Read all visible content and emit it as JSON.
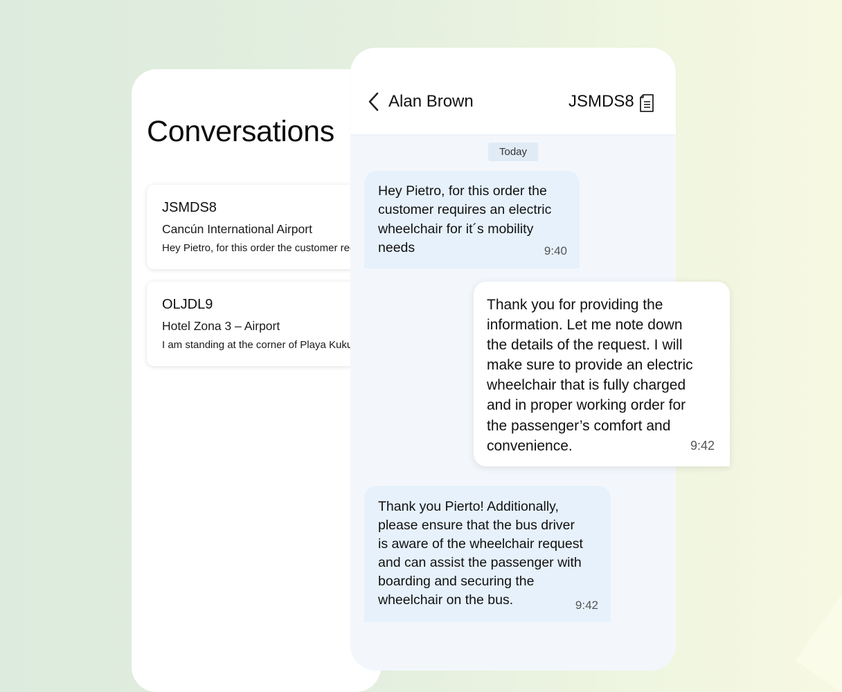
{
  "conversations": {
    "title": "Conversations",
    "items": [
      {
        "code": "JSMDS8",
        "location": "Cancún International Airport",
        "preview": "Hey Pietro, for this order  the customer requires an electric wheelchair"
      },
      {
        "code": "OLJDL9",
        "location": "Hotel Zona 3 – Airport",
        "preview": "I am standing at the corner of Playa Kukulcan"
      }
    ]
  },
  "chat": {
    "contact_name": "Alan Brown",
    "order_code": "JSMDS8",
    "date_label": "Today",
    "messages": [
      {
        "direction": "incoming",
        "text": "Hey Pietro, for this order the\ncustomer requires an electric\nwheelchair for it´s mobility\nneeds",
        "time": "9:40"
      },
      {
        "direction": "outgoing",
        "text": "Thank you for providing the\ninformation. Let me note down\nthe details of the request. I will\nmake sure to provide an electric\nwheelchair that is fully charged\nand in proper working order for\nthe passenger’s comfort and\nconvenience.",
        "time": "9:42"
      },
      {
        "direction": "incoming",
        "text": "Thank you Pierto! Additionally,\nplease ensure that the bus driver\nis aware of the wheelchair request\nand can assist the passenger with\nboarding and securing the\nwheelchair on the bus.",
        "time": "9:42"
      }
    ]
  },
  "icons": {
    "back": "chevron-left-icon",
    "order_details": "document-icon"
  },
  "colors": {
    "incoming_bubble": "#e6f1fb",
    "outgoing_bubble": "#ffffff",
    "chat_background": "#f3f7fc",
    "date_chip": "#e0ebf6"
  }
}
